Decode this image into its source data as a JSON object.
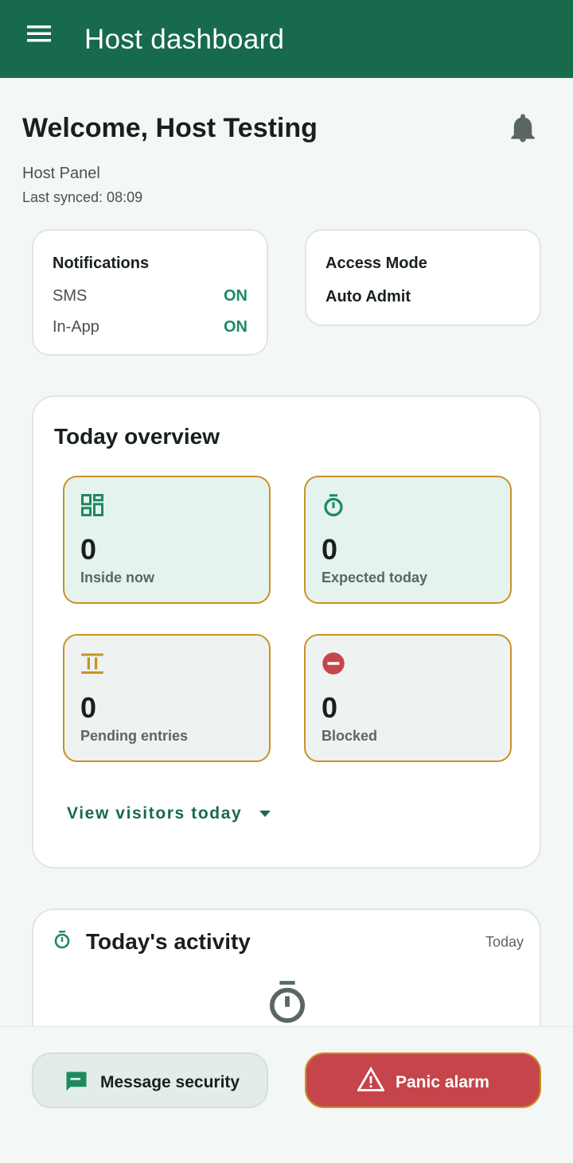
{
  "app_bar": {
    "title": "Host dashboard",
    "menu_icon": "menu-icon",
    "color": "#176a4c"
  },
  "header": {
    "welcome": "Welcome, Host Testing",
    "panel": "Host Panel",
    "last_synced": "Last synced: 08:09",
    "bell_icon": "bell-icon"
  },
  "notifications": {
    "title": "Notifications",
    "rows": [
      {
        "label": "SMS",
        "value": "ON"
      },
      {
        "label": "In-App",
        "value": "ON"
      }
    ]
  },
  "access_mode": {
    "title": "Access Mode",
    "value": "Auto Admit"
  },
  "overview": {
    "title": "Today overview",
    "stats": [
      {
        "value": "0",
        "label": "Inside now",
        "icon": "dashboard-icon"
      },
      {
        "value": "0",
        "label": "Expected today",
        "icon": "timer-icon"
      },
      {
        "value": "0",
        "label": "Pending entries",
        "icon": "pause-icon"
      },
      {
        "value": "0",
        "label": "Blocked",
        "icon": "block-icon"
      }
    ],
    "view_link": "View visitors today"
  },
  "activity": {
    "title": "Today's activity",
    "range": "Today",
    "icon": "timer-icon"
  },
  "actions": {
    "message": "Message security",
    "panic": "Panic alarm",
    "panic_color": "#c6454a"
  }
}
